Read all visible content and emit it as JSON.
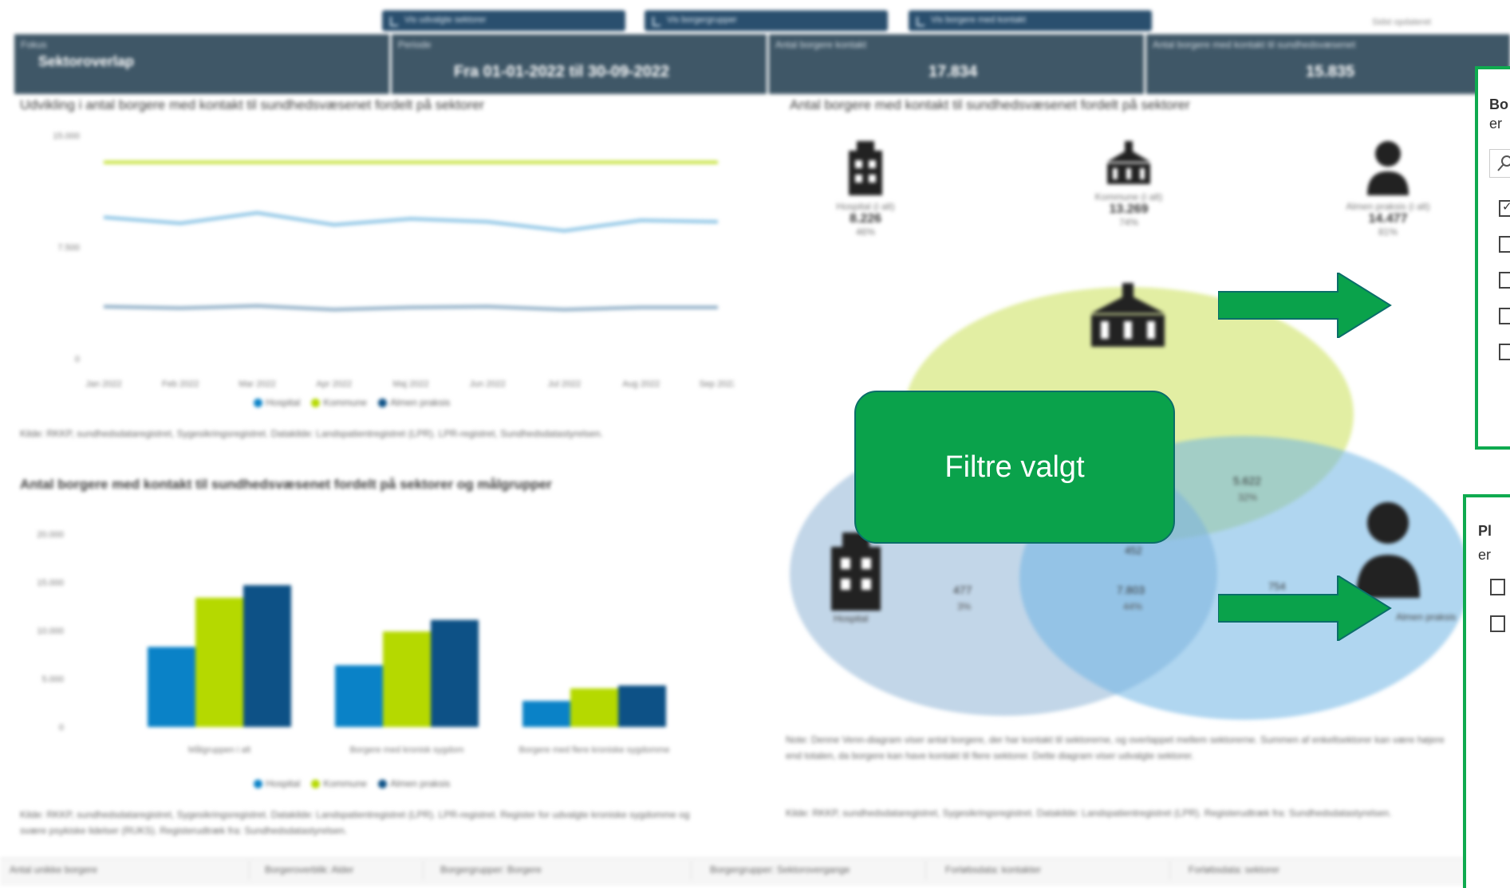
{
  "tabs": [
    {
      "label": "Vis udvalgte sektorer"
    },
    {
      "label": "Vis borgergrupper"
    },
    {
      "label": "Vis borgere med kontakt"
    }
  ],
  "topright_note": "Sidst opdateret",
  "kpis": [
    {
      "header": "Fokus",
      "value": "Sektoroverlap"
    },
    {
      "header": "Periode",
      "value": "Fra 01-01-2022 til 30-09-2022"
    },
    {
      "header": "Antal borgere kontakt",
      "value": "17.834"
    },
    {
      "header": "Antal borgere med kontakt til sundhedsvæsenet",
      "value": "15.835"
    }
  ],
  "line_chart": {
    "title": "Udvikling i antal borgere med kontakt til sundhedsvæsenet fordelt på sektorer",
    "source": "Kilde: RKKP, sundhedsdataregistret, Sygesikringsregistret. Datakilde: Landspatientregistret (LPR). LPR-registret, Sundhedsdatastyrelsen."
  },
  "bar_chart": {
    "title": "Antal borgere med kontakt til sundhedsvæsenet fordelt på sektorer og målgrupper",
    "source": "Kilde: RKKP, sundhedsdataregistret, Sygesikringsregistret. Datakilde: Landspatientregistret (LPR). LPR-registret. Register for udvalgte kroniske sygdomme og svære psykiske lidelser (RUKS). Registerudtræk fra: Sundhedsdatastyrelsen."
  },
  "venn": {
    "title": "Antal borgere med kontakt til sundhedsvæsenet fordelt på sektorer",
    "top_icons": [
      {
        "name": "Hospital (i alt)",
        "value": "8.226",
        "pct": "46%"
      },
      {
        "name": "Kommune (i alt)",
        "value": "13.269",
        "pct": "74%"
      },
      {
        "name": "Almen praksis (i alt)",
        "value": "14.477",
        "pct": "81%"
      }
    ],
    "region_labels": [
      {
        "label": "Hospital"
      },
      {
        "label": "Almen praksis"
      }
    ],
    "region_values": [
      {
        "value": "477",
        "pct": "3%"
      },
      {
        "value": "5.622",
        "pct": "32%"
      },
      {
        "value": "7.803",
        "pct": "44%"
      },
      {
        "value": "452",
        "pct": ""
      },
      {
        "value": "754",
        "pct": ""
      }
    ],
    "note": "Note: Denne Venn-diagram viser antal borgere, der har kontakt til sektorerne, og overlappet mellem sektorerne. Summen af enkeltsektorer kan være højere end totalen, da borgere kan have kontakt til flere sektorer. Dette diagram viser udvalgte sektorer.",
    "source": "Kilde: RKKP, sundhedsdataregistret, Sygesikringsregistret. Datakilde: Landspatientregistret (LPR). Registerudtræk fra: Sundhedsdatastyrelsen."
  },
  "callout": {
    "text": "Filtre valgt"
  },
  "filter_panels": [
    {
      "title": "Bo",
      "sub": "er",
      "checkboxes": 5
    },
    {
      "title": "Pl",
      "sub": "er",
      "checkboxes": 2
    }
  ],
  "bottom_tabs": [
    {
      "label": "Antal unikke borgere"
    },
    {
      "label": "Borgeroverblik: Alder"
    },
    {
      "label": "Borgergrupper: Borgere"
    },
    {
      "label": "Borgergrupper: Sektorovergange"
    },
    {
      "label": "Forløbsdata: kontakter"
    },
    {
      "label": "Forløbsdata: sektorer"
    }
  ],
  "chart_data": [
    {
      "type": "line",
      "title": "Udvikling i antal borgere med kontakt til sundhedsvæsenet fordelt på sektorer",
      "categories": [
        "Jan 2022",
        "Feb 2022",
        "Mar 2022",
        "Apr 2022",
        "Maj 2022",
        "Jun 2022",
        "Jul 2022",
        "Aug 2022",
        "Sep 2022"
      ],
      "ylim": [
        0,
        15000
      ],
      "yticks": [
        "15.000",
        "7.500",
        "0"
      ],
      "series": [
        {
          "name": "Hospital",
          "values": [
            9500,
            9100,
            9800,
            9000,
            9400,
            9200,
            8600,
            9300,
            9200
          ]
        },
        {
          "name": "Kommune",
          "values": [
            13200,
            13200,
            13200,
            13200,
            13200,
            13200,
            13200,
            13200,
            13200
          ]
        },
        {
          "name": "Almen praksis",
          "values": [
            3500,
            3400,
            3550,
            3300,
            3450,
            3500,
            3300,
            3450,
            3450
          ]
        }
      ],
      "legend": "bottom"
    },
    {
      "type": "bar",
      "title": "Antal borgere med kontakt til sundhedsvæsenet fordelt på sektorer og målgrupper",
      "categories": [
        "Målgruppen i alt",
        "Borgere med kronisk sygdom",
        "Borgere med flere kroniske sygdomme"
      ],
      "ylim": [
        0,
        20000
      ],
      "yticks": [
        "20.000",
        "15.000",
        "10.000",
        "5.000",
        "0"
      ],
      "series": [
        {
          "name": "Hospital",
          "values": [
            8300,
            6400,
            2700
          ]
        },
        {
          "name": "Kommune",
          "values": [
            13400,
            9900,
            4000
          ]
        },
        {
          "name": "Almen praksis",
          "values": [
            14700,
            11100,
            4300
          ]
        }
      ],
      "legend": "bottom"
    }
  ],
  "colors": {
    "hospital": "#0a82c7",
    "kommune": "#b5d900",
    "almen": "#0d5186",
    "header": "#3f5767",
    "accent_green": "#0aa24b"
  }
}
